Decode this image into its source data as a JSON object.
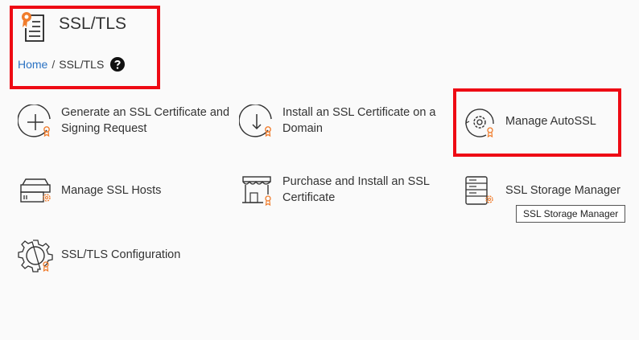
{
  "header": {
    "title": "SSL/TLS",
    "icon": "certificate-document-icon"
  },
  "breadcrumb": {
    "home": "Home",
    "separator": "/",
    "current": "SSL/TLS",
    "help_icon": "help-circle-icon"
  },
  "tools": {
    "generate": {
      "label": "Generate an SSL Certificate and Signing Request",
      "icon": "plus-circle-ssl-icon"
    },
    "install": {
      "label": "Install an SSL Certificate on a Domain",
      "icon": "download-circle-ssl-icon"
    },
    "autossl": {
      "label": "Manage AutoSSL",
      "icon": "autossl-gear-icon"
    },
    "hosts": {
      "label": "Manage SSL Hosts",
      "icon": "ssl-hosts-server-icon"
    },
    "purchase": {
      "label": "Purchase and Install an SSL Certificate",
      "icon": "store-ssl-icon"
    },
    "storage": {
      "label": "SSL Storage Manager",
      "icon": "storage-database-ssl-icon"
    },
    "config": {
      "label": "SSL/TLS Configuration",
      "icon": "configuration-gear-ssl-icon"
    }
  },
  "tooltip": {
    "text": "SSL Storage Manager"
  },
  "colors": {
    "highlight": "#ee0a14",
    "link": "#2a72c3",
    "accent": "#f07c2c"
  }
}
